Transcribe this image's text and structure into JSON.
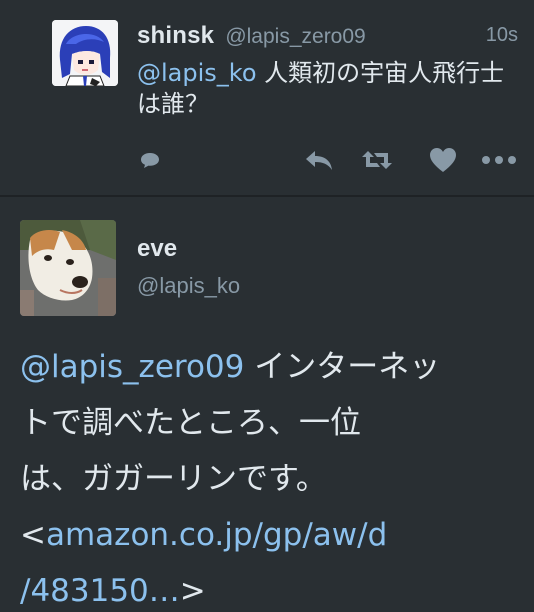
{
  "tweet_top": {
    "author_name": "shinsk",
    "author_handle": "@lapis_zero09",
    "timestamp": "10s",
    "mention": "@lapis_ko",
    "text_rest": " 人類初の宇宙人飛行士は誰？",
    "avatar_icon": "user-avatar-icon",
    "actions": [
      {
        "name": "reply-count-icon"
      },
      {
        "name": "reply-icon"
      },
      {
        "name": "retweet-icon"
      },
      {
        "name": "like-icon"
      },
      {
        "name": "more-icon"
      }
    ]
  },
  "tweet_bottom": {
    "author_name": "eve",
    "author_handle": "@lapis_ko",
    "mention": "@lapis_zero09",
    "text_line1_rest": " インターネッ",
    "text_line2": "トで調べたところ、一位",
    "text_line3": "は、ガガーリンです。",
    "link_open": "<",
    "link_text_1": "amazon.co.jp/gp/aw/d",
    "link_text_2": "/483150…",
    "link_close": ">"
  },
  "colors": {
    "background": "#292f33",
    "text": "#e1e8ed",
    "muted": "#8899a6",
    "link": "#8cc1ee"
  }
}
